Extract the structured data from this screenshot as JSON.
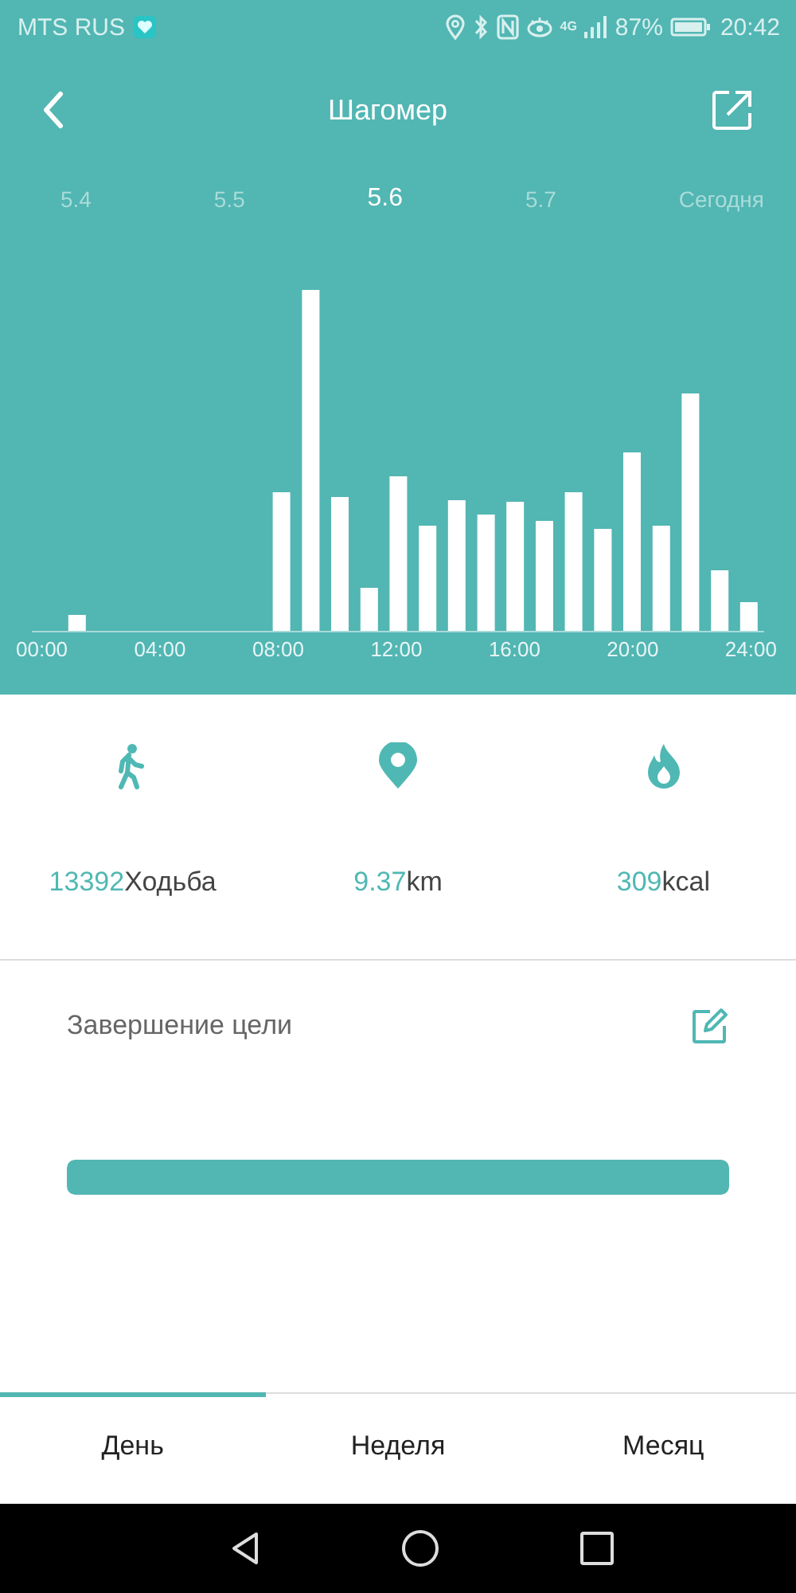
{
  "status_bar": {
    "carrier": "MTS RUS",
    "network": "4G",
    "battery": "87%",
    "time": "20:42"
  },
  "header": {
    "title": "Шагомер"
  },
  "date_tabs": [
    {
      "label": "5.4",
      "selected": false
    },
    {
      "label": "5.5",
      "selected": false
    },
    {
      "label": "5.6",
      "selected": true
    },
    {
      "label": "5.7",
      "selected": false
    },
    {
      "label": "Сегодня",
      "selected": false
    }
  ],
  "chart": {
    "x_labels": [
      "00:00",
      "04:00",
      "08:00",
      "12:00",
      "16:00",
      "20:00",
      "24:00"
    ]
  },
  "stats": [
    {
      "kind": "walk",
      "value": "13392",
      "unit": "Ходьба"
    },
    {
      "kind": "pin",
      "value": "9.37",
      "unit": "km"
    },
    {
      "kind": "flame",
      "value": "309",
      "unit": "kcal"
    }
  ],
  "goal": {
    "title": "Завершение цели",
    "level": 1
  },
  "period_tabs": [
    {
      "label": "День",
      "selected": true
    },
    {
      "label": "Неделя",
      "selected": false
    },
    {
      "label": "Месяц",
      "selected": false
    }
  ]
}
